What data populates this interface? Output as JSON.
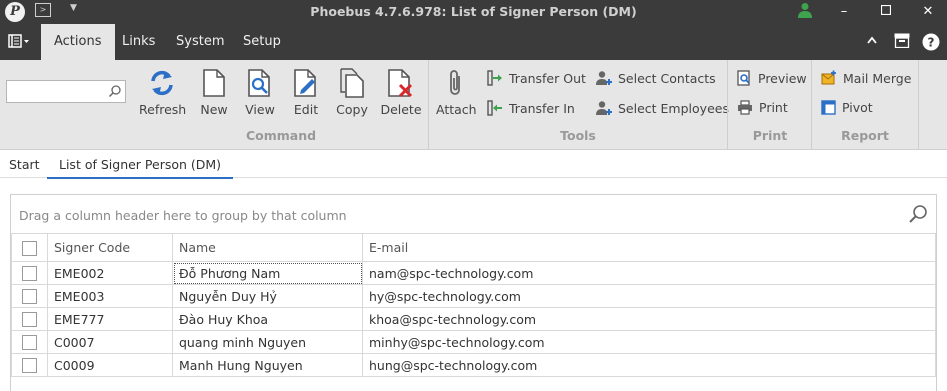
{
  "window": {
    "logo_letter": "P",
    "title": "Phoebus 4.7.6.978: List of Signer Person (DM)"
  },
  "menu": {
    "tabs": [
      {
        "label": "Actions",
        "active": true
      },
      {
        "label": "Links"
      },
      {
        "label": "System"
      },
      {
        "label": "Setup"
      }
    ]
  },
  "ribbon": {
    "search": {
      "value": "",
      "placeholder": ""
    },
    "command": {
      "label": "Command",
      "buttons": [
        "Refresh",
        "New",
        "View",
        "Edit",
        "Copy",
        "Delete"
      ]
    },
    "tools": {
      "label": "Tools",
      "attach": "Attach",
      "transfer_out": "Transfer Out",
      "transfer_in": "Transfer In",
      "select_contacts": "Select Contacts",
      "select_employees": "Select Employees"
    },
    "print": {
      "label": "Print",
      "preview": "Preview",
      "print": "Print"
    },
    "report": {
      "label": "Report",
      "mail_merge": "Mail Merge",
      "pivot": "Pivot"
    }
  },
  "doc_tabs": {
    "start": "Start",
    "current": "List of Signer Person (DM)"
  },
  "grid": {
    "group_hint": "Drag a column header here to group by that column",
    "columns": [
      "Signer Code",
      "Name",
      "E-mail"
    ],
    "rows": [
      {
        "code": "EME002",
        "name": "Đỗ Phương Nam",
        "email": "nam@spc-technology.com"
      },
      {
        "code": "EME003",
        "name": "Nguyễn Duy Hỷ",
        "email": "hy@spc-technology.com"
      },
      {
        "code": "EME777",
        "name": "Đào Huy Khoa",
        "email": "khoa@spc-technology.com"
      },
      {
        "code": "C0007",
        "name": "quang minh Nguyen",
        "email": "minhy@spc-technology.com"
      },
      {
        "code": "C0009",
        "name": "Manh Hung Nguyen",
        "email": "hung@spc-technology.com"
      }
    ]
  },
  "colors": {
    "accent": "#2b6fc6",
    "titlebar": "#3b3b3b",
    "ribbon": "#e6e6e6",
    "delete_red": "#d9282b",
    "user_green": "#3fa34d"
  }
}
